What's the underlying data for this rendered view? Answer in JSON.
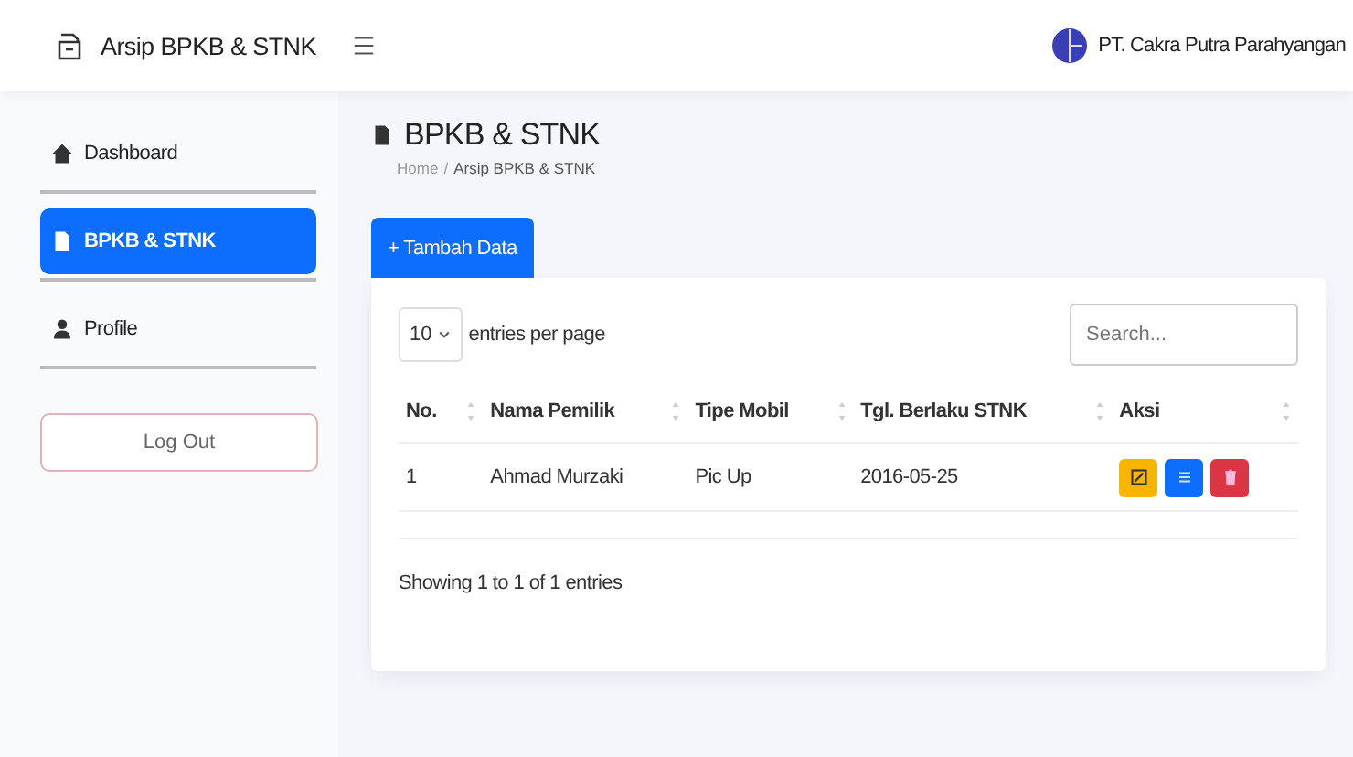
{
  "header": {
    "app_title": "Arsip BPKB & STNK",
    "company": "PT. Cakra Putra Parahyangan"
  },
  "sidebar": {
    "items": [
      {
        "label": "Dashboard",
        "kind": "home",
        "selected": false
      },
      {
        "label": "BPKB & STNK",
        "kind": "file",
        "selected": true
      },
      {
        "label": "Profile",
        "kind": "user",
        "selected": false
      }
    ],
    "logout": "Log Out"
  },
  "page": {
    "title": "BPKB & STNK",
    "breadcrumb": [
      "Home",
      "Arsip BPKB & STNK"
    ],
    "breadcrumb_separator": "/",
    "add_button": "+ Tambah Data"
  },
  "table": {
    "page_size": "10",
    "page_size_label": "entries per page",
    "search_placeholder": "Search...",
    "columns": [
      "No.",
      "Nama Pemilik",
      "Tipe Mobil",
      "Tgl. Berlaku STNK",
      "Aksi"
    ],
    "rows": [
      {
        "cells": [
          "1",
          "Ahmad Murzaki",
          "Pic Up",
          "2016-05-25"
        ],
        "actions": [
          {
            "kind": "edit"
          },
          {
            "kind": "detail"
          },
          {
            "kind": "delete"
          }
        ]
      }
    ],
    "footer": "Showing 1 to 1 of 1 entries"
  }
}
